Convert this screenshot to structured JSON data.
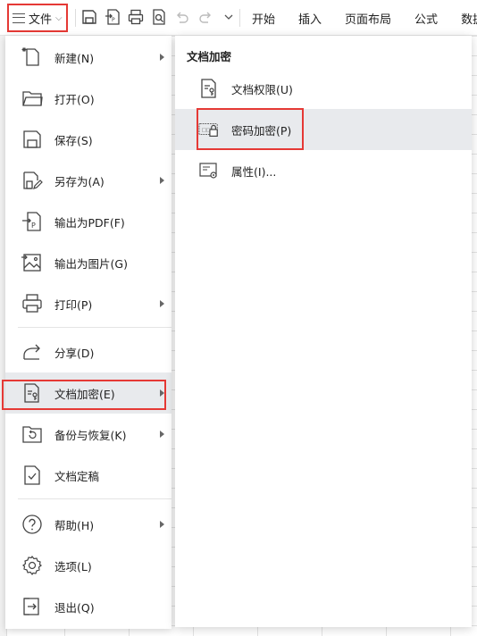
{
  "toolbar": {
    "file_label": "文件",
    "tabs": [
      "开始",
      "插入",
      "页面布局",
      "公式",
      "数据"
    ],
    "icons": [
      "save-icon",
      "export-pdf-icon",
      "print-icon",
      "print-preview-icon",
      "undo-icon",
      "redo-icon",
      "more-icon"
    ]
  },
  "menu": {
    "items": [
      {
        "label": "新建(N)",
        "icon": "new-file-icon",
        "submenu": true
      },
      {
        "label": "打开(O)",
        "icon": "folder-open-icon",
        "submenu": false
      },
      {
        "label": "保存(S)",
        "icon": "save-icon",
        "submenu": false
      },
      {
        "label": "另存为(A)",
        "icon": "save-as-icon",
        "submenu": true
      },
      {
        "label": "输出为PDF(F)",
        "icon": "export-pdf-icon",
        "submenu": false
      },
      {
        "label": "输出为图片(G)",
        "icon": "export-image-icon",
        "submenu": false
      },
      {
        "label": "打印(P)",
        "icon": "print-icon",
        "submenu": true
      },
      {
        "label": "分享(D)",
        "icon": "share-icon",
        "submenu": false
      },
      {
        "label": "文档加密(E)",
        "icon": "document-encrypt-icon",
        "submenu": true,
        "active": true
      },
      {
        "label": "备份与恢复(K)",
        "icon": "backup-restore-icon",
        "submenu": true
      },
      {
        "label": "文档定稿",
        "icon": "document-finalize-icon",
        "submenu": false
      },
      {
        "label": "帮助(H)",
        "icon": "help-icon",
        "submenu": true
      },
      {
        "label": "选项(L)",
        "icon": "settings-icon",
        "submenu": false
      },
      {
        "label": "退出(Q)",
        "icon": "exit-icon",
        "submenu": false
      }
    ]
  },
  "submenu": {
    "title": "文档加密",
    "items": [
      {
        "label": "文档权限(U)",
        "icon": "document-permission-icon"
      },
      {
        "label": "密码加密(P)",
        "icon": "password-encrypt-icon",
        "active": true
      },
      {
        "label": "属性(I)...",
        "icon": "properties-icon"
      }
    ]
  },
  "colors": {
    "highlight": "#e53935",
    "active_bg": "#e8eaed"
  }
}
